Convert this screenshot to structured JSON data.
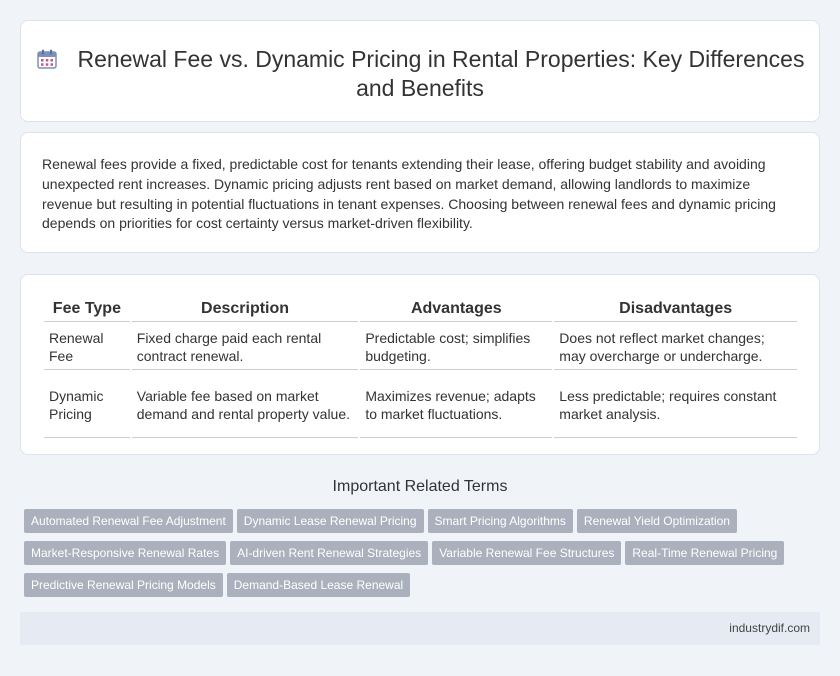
{
  "header": {
    "icon": "calendar-icon",
    "title": "Renewal Fee vs. Dynamic Pricing in Rental Properties: Key Differences and Benefits"
  },
  "intro": {
    "text": "Renewal fees provide a fixed, predictable cost for tenants extending their lease, offering budget stability and avoiding unexpected rent increases. Dynamic pricing adjusts rent based on market demand, allowing landlords to maximize revenue but resulting in potential fluctuations in tenant expenses. Choosing between renewal fees and dynamic pricing depends on priorities for cost certainty versus market-driven flexibility."
  },
  "table": {
    "headers": [
      "Fee Type",
      "Description",
      "Advantages",
      "Disadvantages"
    ],
    "rows": [
      [
        "Renewal Fee",
        "Fixed charge paid each rental contract renewal.",
        "Predictable cost; simplifies budgeting.",
        "Does not reflect market changes; may overcharge or undercharge."
      ],
      [
        "Dynamic Pricing",
        "Variable fee based on market demand and rental property value.",
        "Maximizes revenue; adapts to market fluctuations.",
        "Less predictable; requires constant market analysis."
      ]
    ]
  },
  "related": {
    "title": "Important Related Terms",
    "tags": [
      "Automated Renewal Fee Adjustment",
      "Dynamic Lease Renewal Pricing",
      "Smart Pricing Algorithms",
      "Renewal Yield Optimization",
      "Market-Responsive Renewal Rates",
      "AI-driven Rent Renewal Strategies",
      "Variable Renewal Fee Structures",
      "Real-Time Renewal Pricing",
      "Predictive Renewal Pricing Models",
      "Demand-Based Lease Renewal"
    ]
  },
  "footer": {
    "site": "industrydif.com"
  },
  "colors": {
    "background": "#f0f3f8",
    "tag": "#aab1bd",
    "footer": "#e5eaf3"
  }
}
